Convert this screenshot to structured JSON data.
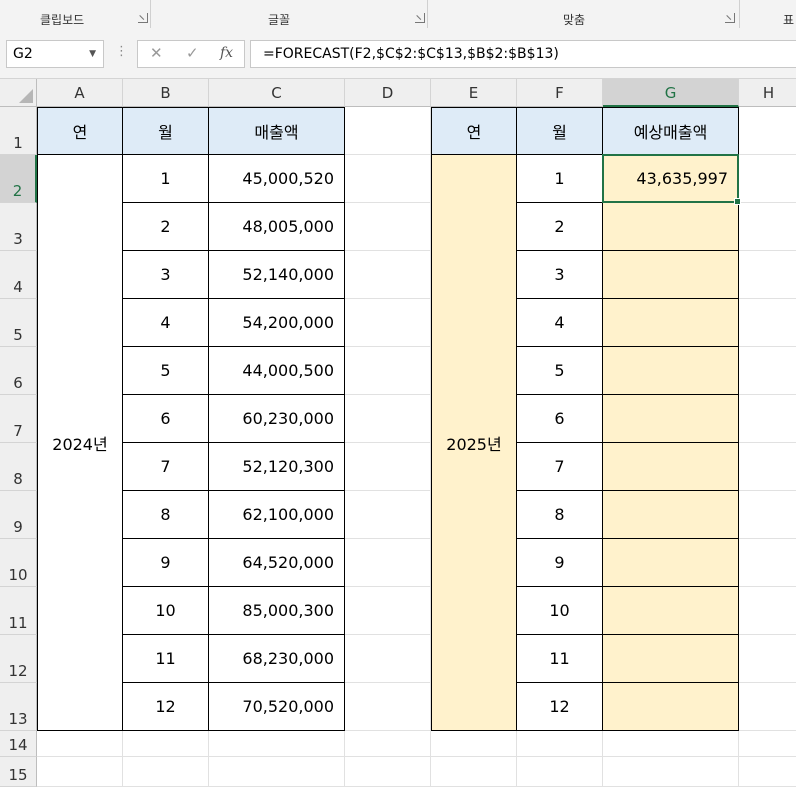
{
  "ribbon": {
    "groups": [
      "클립보드",
      "글꼴",
      "맞춤",
      "표"
    ]
  },
  "formula_bar": {
    "name_box": "G2",
    "cancel_icon": "✕",
    "enter_icon": "✓",
    "fx_label": "fx",
    "formula": "=FORECAST(F2,$C$2:$C$13,$B$2:$B$13)"
  },
  "columns": [
    "A",
    "B",
    "C",
    "D",
    "E",
    "F",
    "G",
    "H"
  ],
  "rows": [
    "1",
    "2",
    "3",
    "4",
    "5",
    "6",
    "7",
    "8",
    "9",
    "10",
    "11",
    "12",
    "13",
    "14",
    "15"
  ],
  "table_2024": {
    "headers": {
      "year": "연",
      "month": "월",
      "sales": "매출액"
    },
    "year": "2024년",
    "months": [
      "1",
      "2",
      "3",
      "4",
      "5",
      "6",
      "7",
      "8",
      "9",
      "10",
      "11",
      "12"
    ],
    "sales": [
      "45,000,520",
      "48,005,000",
      "52,140,000",
      "54,200,000",
      "44,000,500",
      "60,230,000",
      "52,120,300",
      "62,100,000",
      "64,520,000",
      "85,000,300",
      "68,230,000",
      "70,520,000"
    ]
  },
  "table_2025": {
    "headers": {
      "year": "연",
      "month": "월",
      "forecast": "예상매출액"
    },
    "year": "2025년",
    "months": [
      "1",
      "2",
      "3",
      "4",
      "5",
      "6",
      "7",
      "8",
      "9",
      "10",
      "11",
      "12"
    ],
    "forecast": [
      "43,635,997",
      "",
      "",
      "",
      "",
      "",
      "",
      "",
      "",
      "",
      "",
      ""
    ]
  },
  "selected_cell": "G2",
  "colors": {
    "header_fill": "#deebf7",
    "forecast_fill": "#fff2cc",
    "selection": "#217346"
  }
}
